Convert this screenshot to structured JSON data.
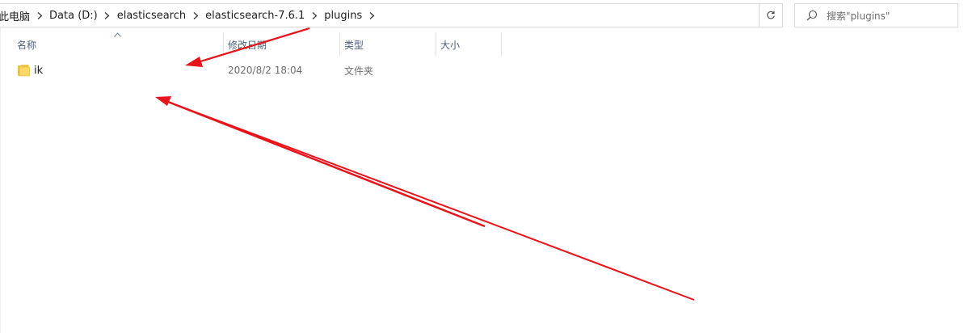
{
  "address_bar": {
    "crumbs": [
      "此电脑",
      "Data (D:)",
      "elasticsearch",
      "elasticsearch-7.6.1",
      "plugins"
    ]
  },
  "search": {
    "placeholder": "搜索\"plugins\""
  },
  "columns": {
    "name": "名称",
    "date_modified": "修改日期",
    "type": "类型",
    "size": "大小"
  },
  "files": [
    {
      "name": "ik",
      "date_modified": "2020/8/2 18:04",
      "type": "文件夹",
      "icon": "folder-icon"
    }
  ],
  "colors": {
    "annotation_arrow": "#e8141b",
    "folder": "#ffd766",
    "header_text": "#4c607a"
  }
}
